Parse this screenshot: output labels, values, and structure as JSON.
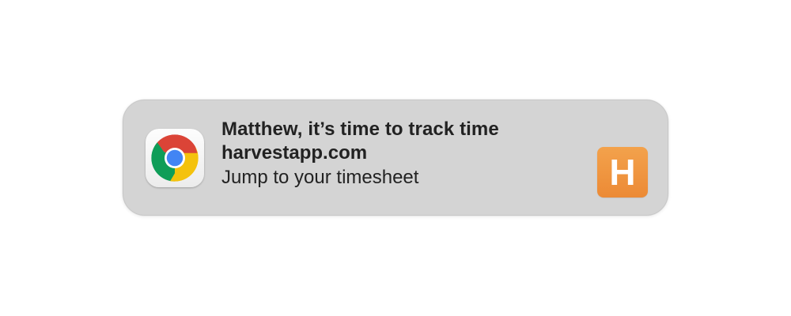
{
  "notification": {
    "app_icon": "chrome-icon",
    "title": "Matthew, it’s time to track time",
    "subtitle": "harvestapp.com",
    "body": "Jump to your timesheet",
    "content_image": {
      "icon": "harvest-logo-icon",
      "letter": "H",
      "color": "#ee8f3a"
    }
  },
  "colors": {
    "background": "#ffffff",
    "notification_bg": "#d4d4d4",
    "text": "#222222"
  }
}
